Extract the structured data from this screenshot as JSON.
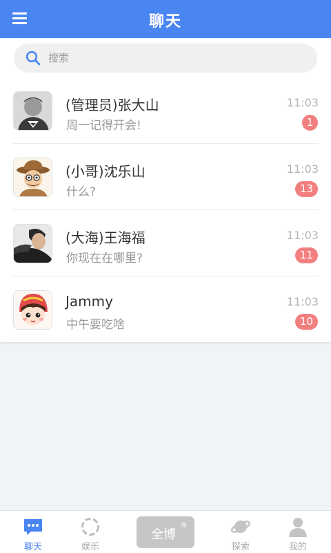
{
  "header": {
    "title": "聊天",
    "menu_icon": "menu-icon"
  },
  "search": {
    "placeholder": "搜索"
  },
  "chats": [
    {
      "name": "(管理员)张大山",
      "message": "周一记得开会!",
      "time": "11:03",
      "badge": "1",
      "avatar": "superman-avatar"
    },
    {
      "name": "(小哥)沈乐山",
      "message": "什么?",
      "time": "11:03",
      "badge": "13",
      "avatar": "cartoon-detective-avatar"
    },
    {
      "name": "(大海)王海福",
      "message": "你现在在哪里?",
      "time": "11:03",
      "badge": "11",
      "avatar": "photo-man-avatar"
    },
    {
      "name": "Jammy",
      "message": "中午要吃啥",
      "time": "11:03",
      "badge": "10",
      "avatar": "cartoon-girl-avatar"
    }
  ],
  "tabbar": {
    "tabs": [
      {
        "label": "聊天",
        "icon": "chat-bubble-icon",
        "active": true
      },
      {
        "label": "娱乐",
        "icon": "loading-ring-icon",
        "active": false
      },
      {
        "label": "探索",
        "icon": "planet-icon",
        "active": false
      },
      {
        "label": "我的",
        "icon": "person-icon",
        "active": false
      }
    ],
    "center": {
      "label": "全博",
      "mark": "®"
    }
  },
  "colors": {
    "primary": "#4a86f2",
    "badge": "#f27f7f",
    "inactive": "#aaaaaa"
  }
}
